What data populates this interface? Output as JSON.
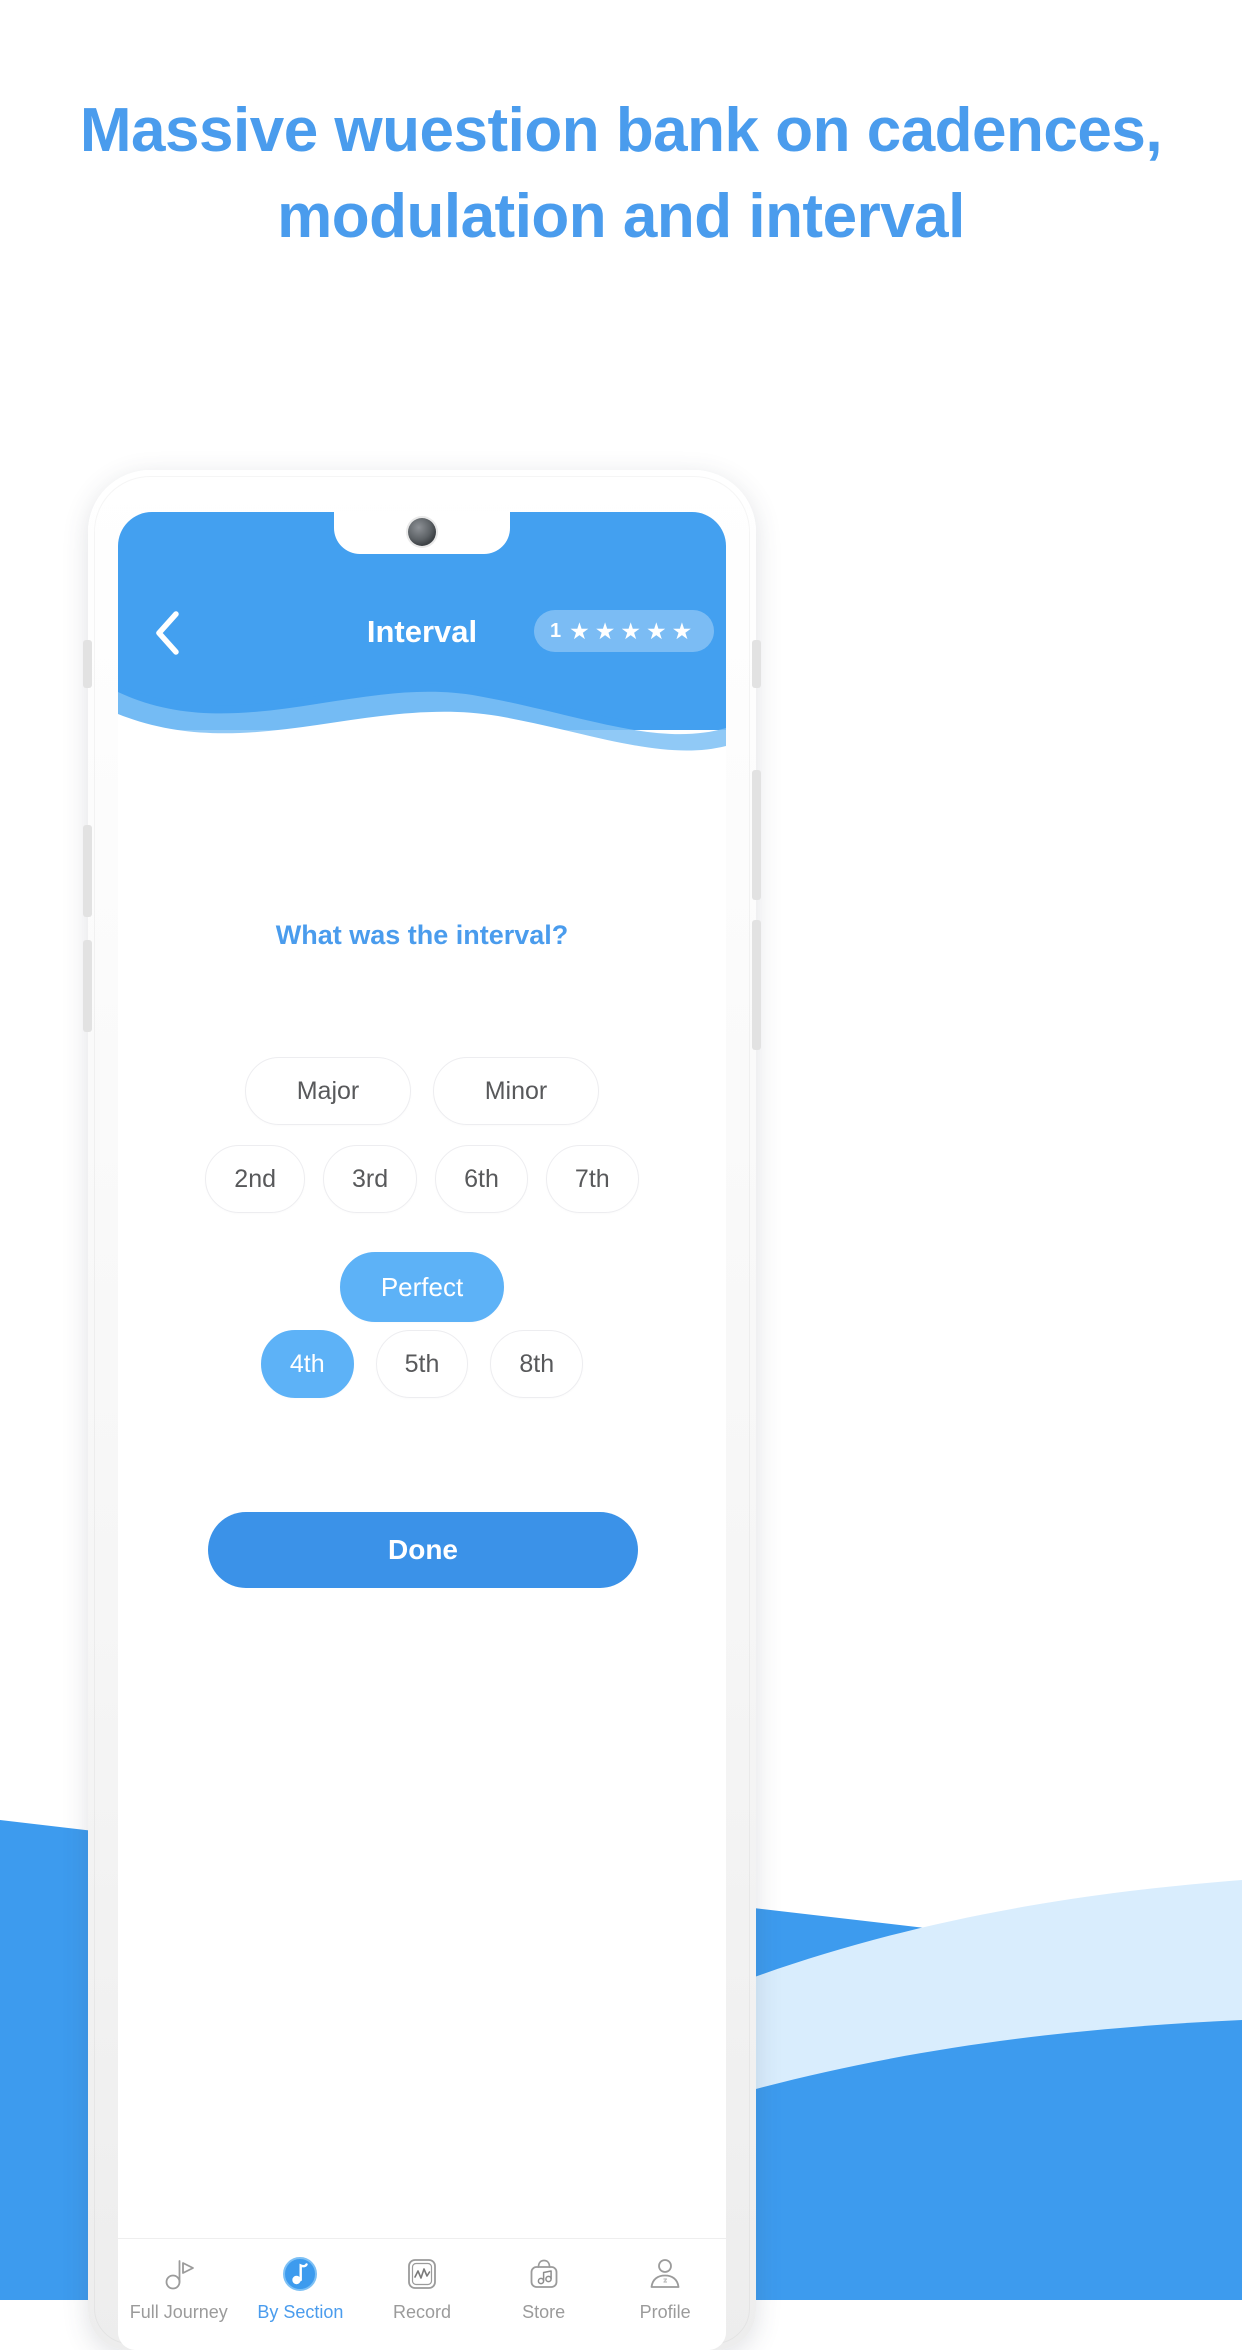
{
  "promo": {
    "headline_line1": "Massive wuestion bank on cadences,",
    "headline_line2": "modulation and interval",
    "headline_color": "#4a9ced"
  },
  "app": {
    "header": {
      "back_icon": "chevron-left-icon",
      "title": "Interval",
      "level_badge": {
        "level": "1",
        "stars": [
          "★",
          "★",
          "★",
          "★",
          "★"
        ],
        "star_count": 5
      },
      "background_color": "#43a0f0"
    },
    "question": {
      "prompt": "What was the interval?"
    },
    "answers": {
      "quality_row": [
        {
          "label": "Major",
          "selected": false
        },
        {
          "label": "Minor",
          "selected": false
        }
      ],
      "number_row": [
        {
          "label": "2nd",
          "selected": false
        },
        {
          "label": "3rd",
          "selected": false
        },
        {
          "label": "6th",
          "selected": false
        },
        {
          "label": "7th",
          "selected": false
        }
      ],
      "perfect_row": [
        {
          "label": "Perfect",
          "selected": true
        }
      ],
      "perfect_number_row": [
        {
          "label": "4th",
          "selected": true
        },
        {
          "label": "5th",
          "selected": false
        },
        {
          "label": "8th",
          "selected": false
        }
      ],
      "selected_color": "#5db2f7",
      "unselected_text_color": "#58595b"
    },
    "done_button": {
      "label": "Done",
      "color": "#3b92e8"
    },
    "bottom_nav": {
      "active_index": 1,
      "items": [
        {
          "label": "Full Journey",
          "icon": "music-note-play-icon",
          "active": false
        },
        {
          "label": "By Section",
          "icon": "music-note-circle-icon",
          "active": true
        },
        {
          "label": "Record",
          "icon": "waveform-square-icon",
          "active": false
        },
        {
          "label": "Store",
          "icon": "shopping-bag-music-icon",
          "active": false
        },
        {
          "label": "Profile",
          "icon": "person-icon",
          "active": false
        }
      ],
      "active_color": "#4a9ced",
      "inactive_color": "#9b9b9b"
    }
  },
  "background": {
    "wave_color": "#3d9bee",
    "wave_color_light": "#daeeff"
  }
}
